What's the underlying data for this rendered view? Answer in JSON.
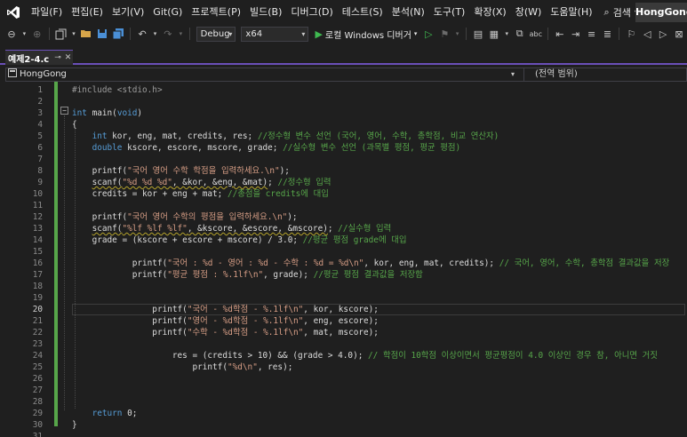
{
  "menu": {
    "items": [
      "파일(F)",
      "편집(E)",
      "보기(V)",
      "Git(G)",
      "프로젝트(P)",
      "빌드(B)",
      "디버그(D)",
      "테스트(S)",
      "분석(N)",
      "도구(T)",
      "확장(X)",
      "창(W)",
      "도움말(H)"
    ],
    "search_label": "검색",
    "solution_name": "HongGong"
  },
  "toolbar": {
    "configuration": "Debug",
    "platform": "x64",
    "run_label": "로컬 Windows 디버거"
  },
  "tab": {
    "title": "예제2-4.c"
  },
  "navbar": {
    "project": "HongGong",
    "scope": "(전역 범위)"
  },
  "editor": {
    "current_line": 20,
    "lines": [
      {
        "n": "1",
        "segments": [
          {
            "t": "#include <stdio.h>",
            "c": "pp"
          }
        ]
      },
      {
        "n": "2",
        "segments": []
      },
      {
        "n": "3",
        "segments": [
          {
            "t": "int",
            "c": "kw"
          },
          {
            "t": " main(",
            "c": "plain"
          },
          {
            "t": "void",
            "c": "kw"
          },
          {
            "t": ")",
            "c": "plain"
          }
        ]
      },
      {
        "n": "4",
        "segments": [
          {
            "t": "{",
            "c": "plain"
          }
        ]
      },
      {
        "n": "5",
        "segments": [
          {
            "t": "    int",
            "c": "kw"
          },
          {
            "t": " kor, eng, mat, credits, res; ",
            "c": "plain"
          },
          {
            "t": "//정수형 변수 선언 (국어, 영어, 수학, 총학점, 비교 연산자)",
            "c": "cmt"
          }
        ]
      },
      {
        "n": "6",
        "segments": [
          {
            "t": "    double",
            "c": "kw"
          },
          {
            "t": " kscore, escore, mscore, grade; ",
            "c": "plain"
          },
          {
            "t": "//실수형 변수 선언 (과목별 평점, 평균 평점)",
            "c": "cmt"
          }
        ]
      },
      {
        "n": "7",
        "segments": []
      },
      {
        "n": "8",
        "segments": [
          {
            "t": "    printf(",
            "c": "plain"
          },
          {
            "t": "\"국어 영어 수학 학점을 입력하세요.\\n\"",
            "c": "str"
          },
          {
            "t": ");",
            "c": "plain"
          }
        ]
      },
      {
        "n": "9",
        "segments": [
          {
            "t": "    ",
            "c": "plain"
          },
          {
            "t": "scanf(",
            "c": "squig"
          },
          {
            "t": "\"%d %d %d\"",
            "c": "strsquig"
          },
          {
            "t": ", &kor, &eng, &mat)",
            "c": "squig"
          },
          {
            "t": "; ",
            "c": "plain"
          },
          {
            "t": "//정수형 입력",
            "c": "cmt"
          }
        ]
      },
      {
        "n": "10",
        "segments": [
          {
            "t": "    credits = kor + eng + mat; ",
            "c": "plain"
          },
          {
            "t": "//총점을 credits에 대입",
            "c": "cmt"
          }
        ]
      },
      {
        "n": "11",
        "segments": []
      },
      {
        "n": "12",
        "segments": [
          {
            "t": "    printf(",
            "c": "plain"
          },
          {
            "t": "\"국어 영어 수학의 평점을 입력하세요.\\n\"",
            "c": "str"
          },
          {
            "t": ");",
            "c": "plain"
          }
        ]
      },
      {
        "n": "13",
        "segments": [
          {
            "t": "    ",
            "c": "plain"
          },
          {
            "t": "scanf(",
            "c": "squig"
          },
          {
            "t": "\"%lf %lf %lf\"",
            "c": "strsquig"
          },
          {
            "t": ", &kscore, &escore, &mscore)",
            "c": "squig"
          },
          {
            "t": "; ",
            "c": "plain"
          },
          {
            "t": "//실수형 입력",
            "c": "cmt"
          }
        ]
      },
      {
        "n": "14",
        "segments": [
          {
            "t": "    grade = (kscore + escore + mscore) / 3.0; ",
            "c": "plain"
          },
          {
            "t": "//평균 평점 grade에 대입",
            "c": "cmt"
          }
        ]
      },
      {
        "n": "15",
        "segments": []
      },
      {
        "n": "16",
        "segments": [
          {
            "t": "            printf(",
            "c": "plain"
          },
          {
            "t": "\"국어 : %d - 영어 : %d - 수학 : %d = %d\\n\"",
            "c": "str"
          },
          {
            "t": ", kor, eng, mat, credits); ",
            "c": "plain"
          },
          {
            "t": "// 국어, 영어, 수학, 총학점 결과값을 저장",
            "c": "cmt"
          }
        ]
      },
      {
        "n": "17",
        "segments": [
          {
            "t": "            printf(",
            "c": "plain"
          },
          {
            "t": "\"평균 평점 : %.1lf\\n\"",
            "c": "str"
          },
          {
            "t": ", grade); ",
            "c": "plain"
          },
          {
            "t": "//평균 평점 결과값을 저장함",
            "c": "cmt"
          }
        ]
      },
      {
        "n": "18",
        "segments": []
      },
      {
        "n": "19",
        "segments": []
      },
      {
        "n": "20",
        "segments": [
          {
            "t": "                printf(",
            "c": "plain"
          },
          {
            "t": "\"국어 - %d학점 - %.1lf\\n\"",
            "c": "str"
          },
          {
            "t": ", kor, kscore);",
            "c": "plain"
          }
        ]
      },
      {
        "n": "21",
        "segments": [
          {
            "t": "                printf(",
            "c": "plain"
          },
          {
            "t": "\"영어 - %d학점 - %.1lf\\n\"",
            "c": "str"
          },
          {
            "t": ", eng, escore);",
            "c": "plain"
          }
        ]
      },
      {
        "n": "22",
        "segments": [
          {
            "t": "                printf(",
            "c": "plain"
          },
          {
            "t": "\"수학 - %d학점 - %.1lf\\n\"",
            "c": "str"
          },
          {
            "t": ", mat, mscore);",
            "c": "plain"
          }
        ]
      },
      {
        "n": "23",
        "segments": []
      },
      {
        "n": "24",
        "segments": [
          {
            "t": "                    res = (credits > 10) && (grade > 4.0); ",
            "c": "plain"
          },
          {
            "t": "// 학점이 10학점 이상이면서 평균평점이 4.0 이상인 경우 참, 아니면 거짓",
            "c": "cmt"
          }
        ]
      },
      {
        "n": "25",
        "segments": [
          {
            "t": "                        printf(",
            "c": "plain"
          },
          {
            "t": "\"%d\\n\"",
            "c": "str"
          },
          {
            "t": ", res);",
            "c": "plain"
          }
        ]
      },
      {
        "n": "26",
        "segments": []
      },
      {
        "n": "27",
        "segments": []
      },
      {
        "n": "28",
        "segments": []
      },
      {
        "n": "29",
        "segments": [
          {
            "t": "    return",
            "c": "kw"
          },
          {
            "t": " 0;",
            "c": "plain"
          }
        ]
      },
      {
        "n": "30",
        "segments": [
          {
            "t": "}",
            "c": "plain"
          }
        ]
      },
      {
        "n": "31",
        "segments": []
      }
    ]
  }
}
